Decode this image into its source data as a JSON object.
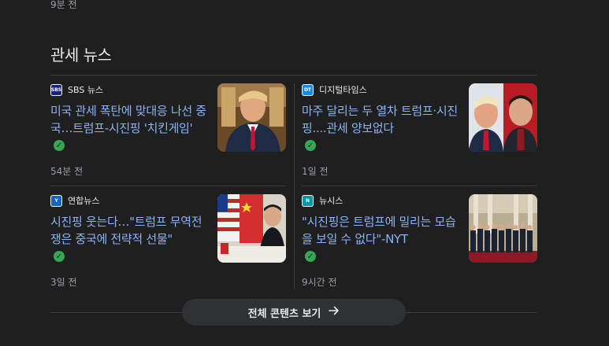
{
  "previous": {
    "time": "9분 전"
  },
  "section": {
    "title": "관세 뉴스"
  },
  "articles": [
    {
      "source": "SBS 뉴스",
      "favicon_text": "SBS",
      "favicon_color": "#1a237e",
      "headline": "미국 관세 폭탄에 맞대응 나선 중국…트럼프-시진핑 '치킨게임'",
      "time": "54분 전"
    },
    {
      "source": "디지털타임스",
      "favicon_text": "DT",
      "favicon_color": "#1e88e5",
      "headline": "마주 달리는 두 열차 트럼프·시진핑....관세 양보없다",
      "time": "1일 전"
    },
    {
      "source": "연합뉴스",
      "favicon_text": "Y",
      "favicon_color": "#1565c0",
      "headline": "시진핑 웃는다…\"트럼프 무역전쟁은 중국에 전략적 선물\"",
      "time": "3일 전"
    },
    {
      "source": "뉴시스",
      "favicon_text": "N",
      "favicon_color": "#0097a7",
      "headline": "\"시진핑은 트럼프에 밀리는 모습을 보일 수 없다\"-NYT",
      "time": "9시간 전"
    }
  ],
  "more_button": {
    "label": "전체 콘텐츠 보기",
    "icon": "arrow-right-icon"
  }
}
